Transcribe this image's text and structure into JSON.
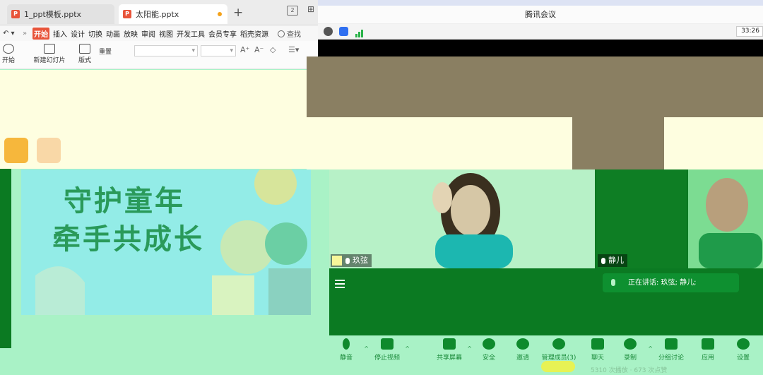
{
  "editor": {
    "tabs": [
      {
        "label": "1_ppt模板.pptx"
      },
      {
        "label": "太阳能.pptx"
      }
    ],
    "add_tab": "+",
    "menu": [
      "开始",
      "插入",
      "设计",
      "切换",
      "动画",
      "放映",
      "审阅",
      "视图",
      "开发工具",
      "会员专享",
      "稻壳资源"
    ],
    "search_label": "查找",
    "toolbar": {
      "start_label": "开始",
      "new_slide_label": "新建幻灯片",
      "layout_label": "版式",
      "reset_label": "重置"
    },
    "slide": {
      "title_line1": "守护童年",
      "title_line2": "牵手共成长"
    }
  },
  "meeting": {
    "window_title": "腾讯会议",
    "timer": "33:26",
    "participants": [
      {
        "name": "玖弦"
      },
      {
        "name": "静儿"
      }
    ],
    "speaking": "正在讲话: 玖弦; 静儿;",
    "controls": [
      {
        "label": "静音",
        "icon": "mic-icon"
      },
      {
        "label": "停止视频",
        "icon": "video-icon"
      },
      {
        "label": "共享屏幕",
        "icon": "share-screen-icon"
      },
      {
        "label": "安全",
        "icon": "shield-icon"
      },
      {
        "label": "邀请",
        "icon": "invite-icon"
      },
      {
        "label": "管理成员(3)",
        "icon": "members-icon"
      },
      {
        "label": "聊天",
        "icon": "chat-icon"
      },
      {
        "label": "录制",
        "icon": "record-icon"
      },
      {
        "label": "分组讨论",
        "icon": "breakout-icon"
      },
      {
        "label": "应用",
        "icon": "apps-icon"
      },
      {
        "label": "设置",
        "icon": "gear-icon"
      }
    ],
    "footer_stats": "5310 次播放 · 673 次点赞"
  },
  "colors": {
    "meeting_green": "#0b7a22",
    "overlay_mint": "#a9f2c6",
    "cream": "#fefee0",
    "wps_red": "#e8543a"
  }
}
